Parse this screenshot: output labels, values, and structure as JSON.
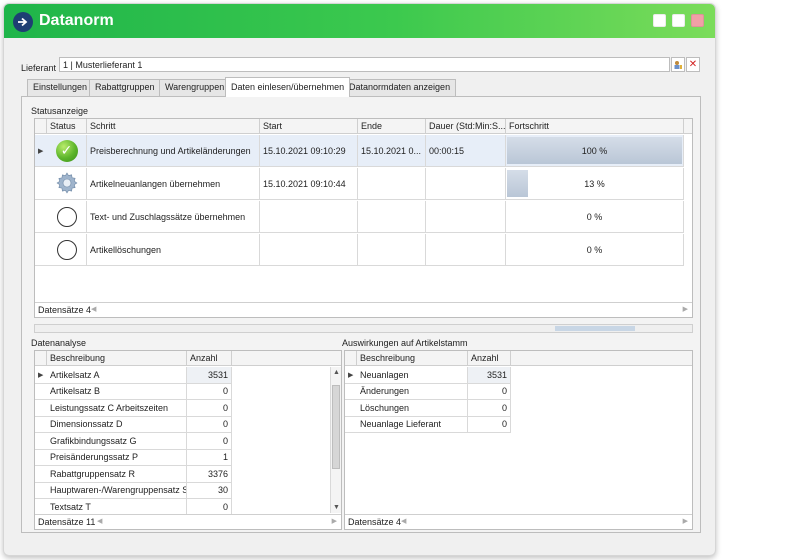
{
  "window": {
    "title": "Datanorm",
    "app_icon": "arrow-right-circle-icon"
  },
  "supplier": {
    "label": "Lieferant",
    "value": "1 | Musterlieferant 1"
  },
  "tabs": [
    {
      "label": "Einstellungen"
    },
    {
      "label": "Rabattgruppen"
    },
    {
      "label": "Warengruppen"
    },
    {
      "label": "Daten einlesen/übernehmen",
      "active": true
    },
    {
      "label": "Datanormdaten anzeigen"
    }
  ],
  "status": {
    "group_title": "Statusanzeige",
    "columns": [
      "Status",
      "Schritt",
      "Start",
      "Ende",
      "Dauer (Std:Min:S...",
      "Fortschritt"
    ],
    "rows": [
      {
        "status": "ok",
        "step": "Preisberechnung und Artikeländerungen",
        "start": "15.10.2021 09:10:29",
        "end": "15.10.2021 0...",
        "duration": "00:00:15",
        "progress": 100,
        "progress_label": "100 %"
      },
      {
        "status": "running",
        "step": "Artikelneuanlangen übernehmen",
        "start": "15.10.2021 09:10:44",
        "end": "",
        "duration": "",
        "progress": 13,
        "progress_label": "13 %"
      },
      {
        "status": "pending",
        "step": "Text- und Zuschlagssätze übernehmen",
        "start": "",
        "end": "",
        "duration": "",
        "progress": 0,
        "progress_label": "0 %"
      },
      {
        "status": "pending",
        "step": "Artikellöschungen",
        "start": "",
        "end": "",
        "duration": "",
        "progress": 0,
        "progress_label": "0 %"
      }
    ],
    "footer": "Datensätze 4"
  },
  "analysis": {
    "group_title": "Datenanalyse",
    "columns": [
      "Beschreibung",
      "Anzahl"
    ],
    "rows": [
      {
        "desc": "Artikelsatz A",
        "count": "3531"
      },
      {
        "desc": "Artikelsatz B",
        "count": "0"
      },
      {
        "desc": "Leistungssatz C Arbeitszeiten",
        "count": "0"
      },
      {
        "desc": "Dimensionssatz D",
        "count": "0"
      },
      {
        "desc": "Grafikbindungssatz G",
        "count": "0"
      },
      {
        "desc": "Preisänderungssatz P",
        "count": "1"
      },
      {
        "desc": "Rabattgruppensatz R",
        "count": "3376"
      },
      {
        "desc": "Hauptwaren-/Warengruppensatz S",
        "count": "30"
      },
      {
        "desc": "Textsatz T",
        "count": "0"
      }
    ],
    "footer": "Datensätze 11"
  },
  "effects": {
    "group_title": "Auswirkungen auf Artikelstamm",
    "columns": [
      "Beschreibung",
      "Anzahl"
    ],
    "rows": [
      {
        "desc": "Neuanlagen",
        "count": "3531"
      },
      {
        "desc": "Änderungen",
        "count": "0"
      },
      {
        "desc": "Löschungen",
        "count": "0"
      },
      {
        "desc": "Neuanlage Lieferant",
        "count": "0"
      }
    ],
    "footer": "Datensätze 4"
  }
}
